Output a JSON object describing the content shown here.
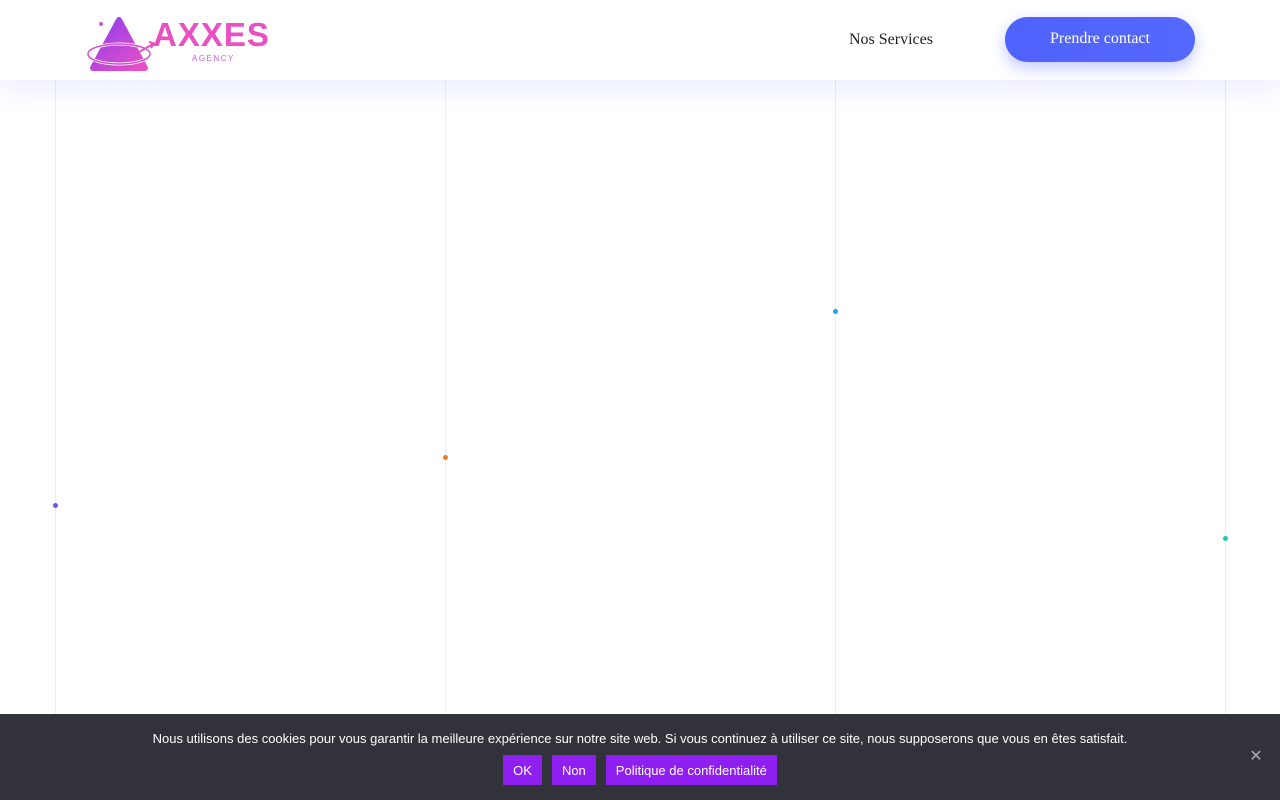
{
  "header": {
    "logo": {
      "name": "AXXES",
      "subtitle": "AGENCY",
      "color_primary": "#ea4fc4",
      "color_secondary": "#8e3ff0"
    },
    "nav": [
      {
        "label": "Nos Services"
      }
    ],
    "cta_label": "Prendre contact",
    "cta_color": "#4f62fb"
  },
  "decor": {
    "dot_colors": [
      "#7c4df2",
      "#f07a1e",
      "#17a8e6",
      "#1ec9b4"
    ]
  },
  "cookie_notice": {
    "text": "Nous utilisons des cookies pour vous garantir la meilleure expérience sur notre site web. Si vous continuez à utiliser ce site, nous supposerons que vous en êtes satisfait.",
    "buttons": {
      "ok": "OK",
      "no": "Non",
      "policy": "Politique de confidentialité"
    },
    "close_icon": "close-icon",
    "button_color": "#8f1ef1",
    "background_color": "#32323a"
  }
}
